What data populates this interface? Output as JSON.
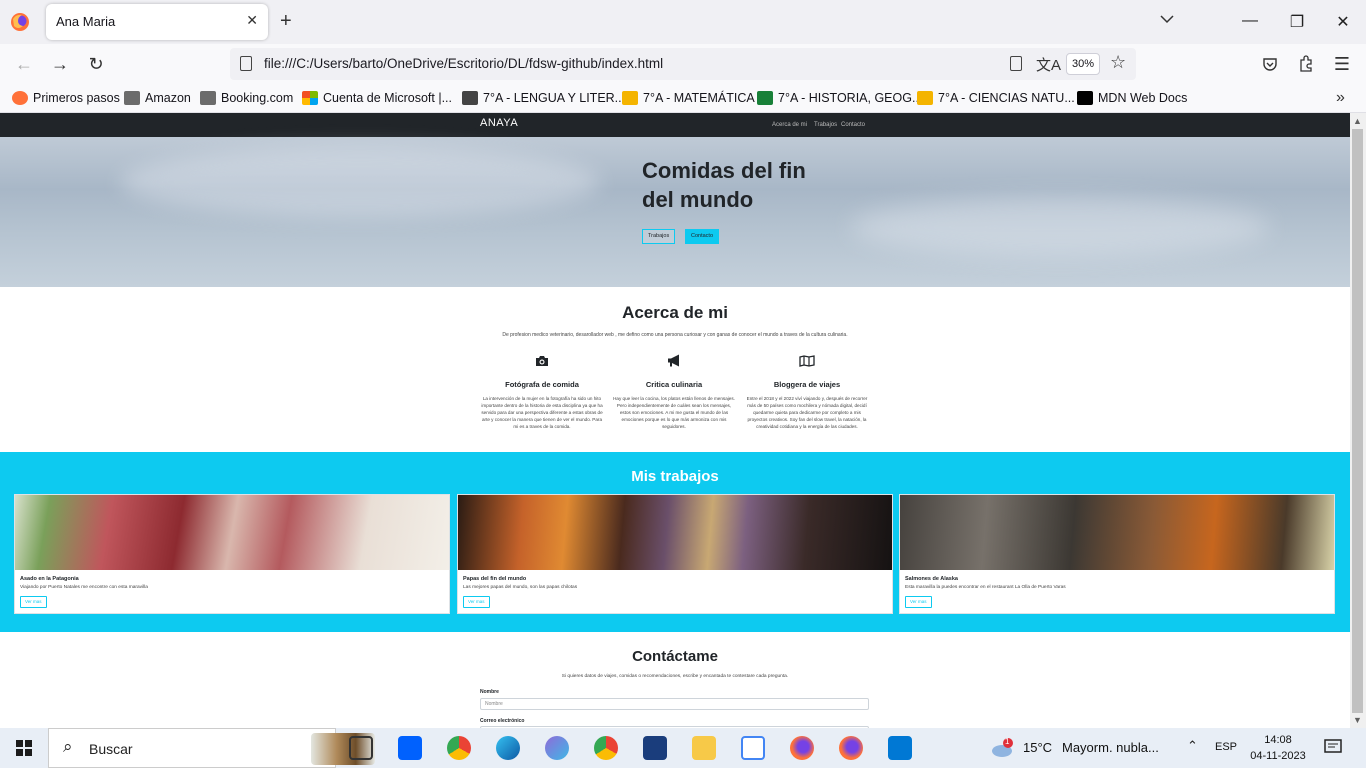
{
  "browser": {
    "tab_title": "Ana Maria",
    "url": "file:///C:/Users/barto/OneDrive/Escritorio/DL/fdsw-github/index.html",
    "zoom": "30%"
  },
  "bookmarks": [
    {
      "label": "Primeros pasos",
      "icon": "firefox-icon",
      "color": "#ff7139"
    },
    {
      "label": "Amazon",
      "icon": "amazon-icon",
      "color": "#6b6b6b"
    },
    {
      "label": "Booking.com",
      "icon": "booking-icon",
      "color": "#6b6b6b"
    },
    {
      "label": "Cuenta de Microsoft |...",
      "icon": "microsoft-icon",
      "color": "#f25022"
    },
    {
      "label": "7°A - LENGUA Y LITER...",
      "icon": "classroom-icon",
      "color": "#444444"
    },
    {
      "label": "7°A - MATEMÁTICA",
      "icon": "classroom-icon",
      "color": "#f4b400"
    },
    {
      "label": "7°A - HISTORIA, GEOG...",
      "icon": "classroom-icon",
      "color": "#188038"
    },
    {
      "label": "7°A - CIENCIAS NATU...",
      "icon": "classroom-icon",
      "color": "#f4b400"
    },
    {
      "label": "MDN Web Docs",
      "icon": "mdn-icon",
      "color": "#000000"
    }
  ],
  "site": {
    "brand": "ANAYA",
    "nav": [
      "Acerca de mi",
      "Trabajos",
      "Contacto"
    ],
    "hero": {
      "title": "Comidas del fin del mundo",
      "btn1": "Trabajos",
      "btn2": "Contacto"
    },
    "about": {
      "title": "Acerca de mi",
      "desc": "De profesion medico veterinario, desarollador web , me defino como una persona curiosar y con ganas de conocer el mundo a traves de la cultura culinaria.",
      "features": [
        {
          "icon": "camera-icon",
          "glyph": "📷",
          "title": "Fotógrafa de comida",
          "text": "La intervención de la mujer en la fotografía ha sido un hito importante dentro de la historia de esta disciplina ya que ha servido para dar una perspectiva diferente a estas obras de arte y conocer la manera que tienen de ver el mundo. Para mi es a traves de la comida."
        },
        {
          "icon": "megaphone-icon",
          "glyph": "📢",
          "title": "Critica culinaria",
          "text": "Hay que leer la cocina, los platos están llenos de mensajes. Pero independientemente de cuáles sean los mensajes, estos son emociones. A mi me gusta el mundo de las emociones porque es lo que más armoniza con mis seguidores."
        },
        {
          "icon": "map-icon",
          "glyph": "🗺",
          "title": "Bloggera de viajes",
          "text": "Entre el 2018 y el 2022 viví viajando y, después de recorrer más de 50 países como mochilera y nómada digital, decidí quedarme quieta para dedicarme por completo a mis proyectos creativos. Soy fan del slow travel, la natación, la creatividad cotidiana y la energía de las ciudades."
        }
      ]
    },
    "works": {
      "title": "Mis trabajos",
      "cards": [
        {
          "title": "Asado en la Patagonia",
          "text": "Viajando por Puerto Natales me encontre con esta maravilla",
          "button": "Ver mas"
        },
        {
          "title": "Papas del fin del mundo",
          "text": "Las mejores papas del mundo, son las papas chilotas",
          "button": "Ver mas"
        },
        {
          "title": "Salmones de Alaska",
          "text": "Esta maravilla la puedes encontrar en el restaurant La Olla de Puerto Varas",
          "button": "Ver mas"
        }
      ]
    },
    "contact": {
      "title": "Contáctame",
      "desc": "Si quieres datos de viajes, comidas o recomendaciones, escribe y encantada te contestare cada pregunta.",
      "name_label": "Nombre",
      "name_placeholder": "Nombre",
      "email_label": "Correo electrónico"
    }
  },
  "taskbar": {
    "search": "Buscar",
    "weather_temp": "15°C",
    "weather_desc": "Mayorm. nubla...",
    "lang": "ESP",
    "time": "14:08",
    "date": "04-11-2023",
    "weather_badge": "1"
  }
}
